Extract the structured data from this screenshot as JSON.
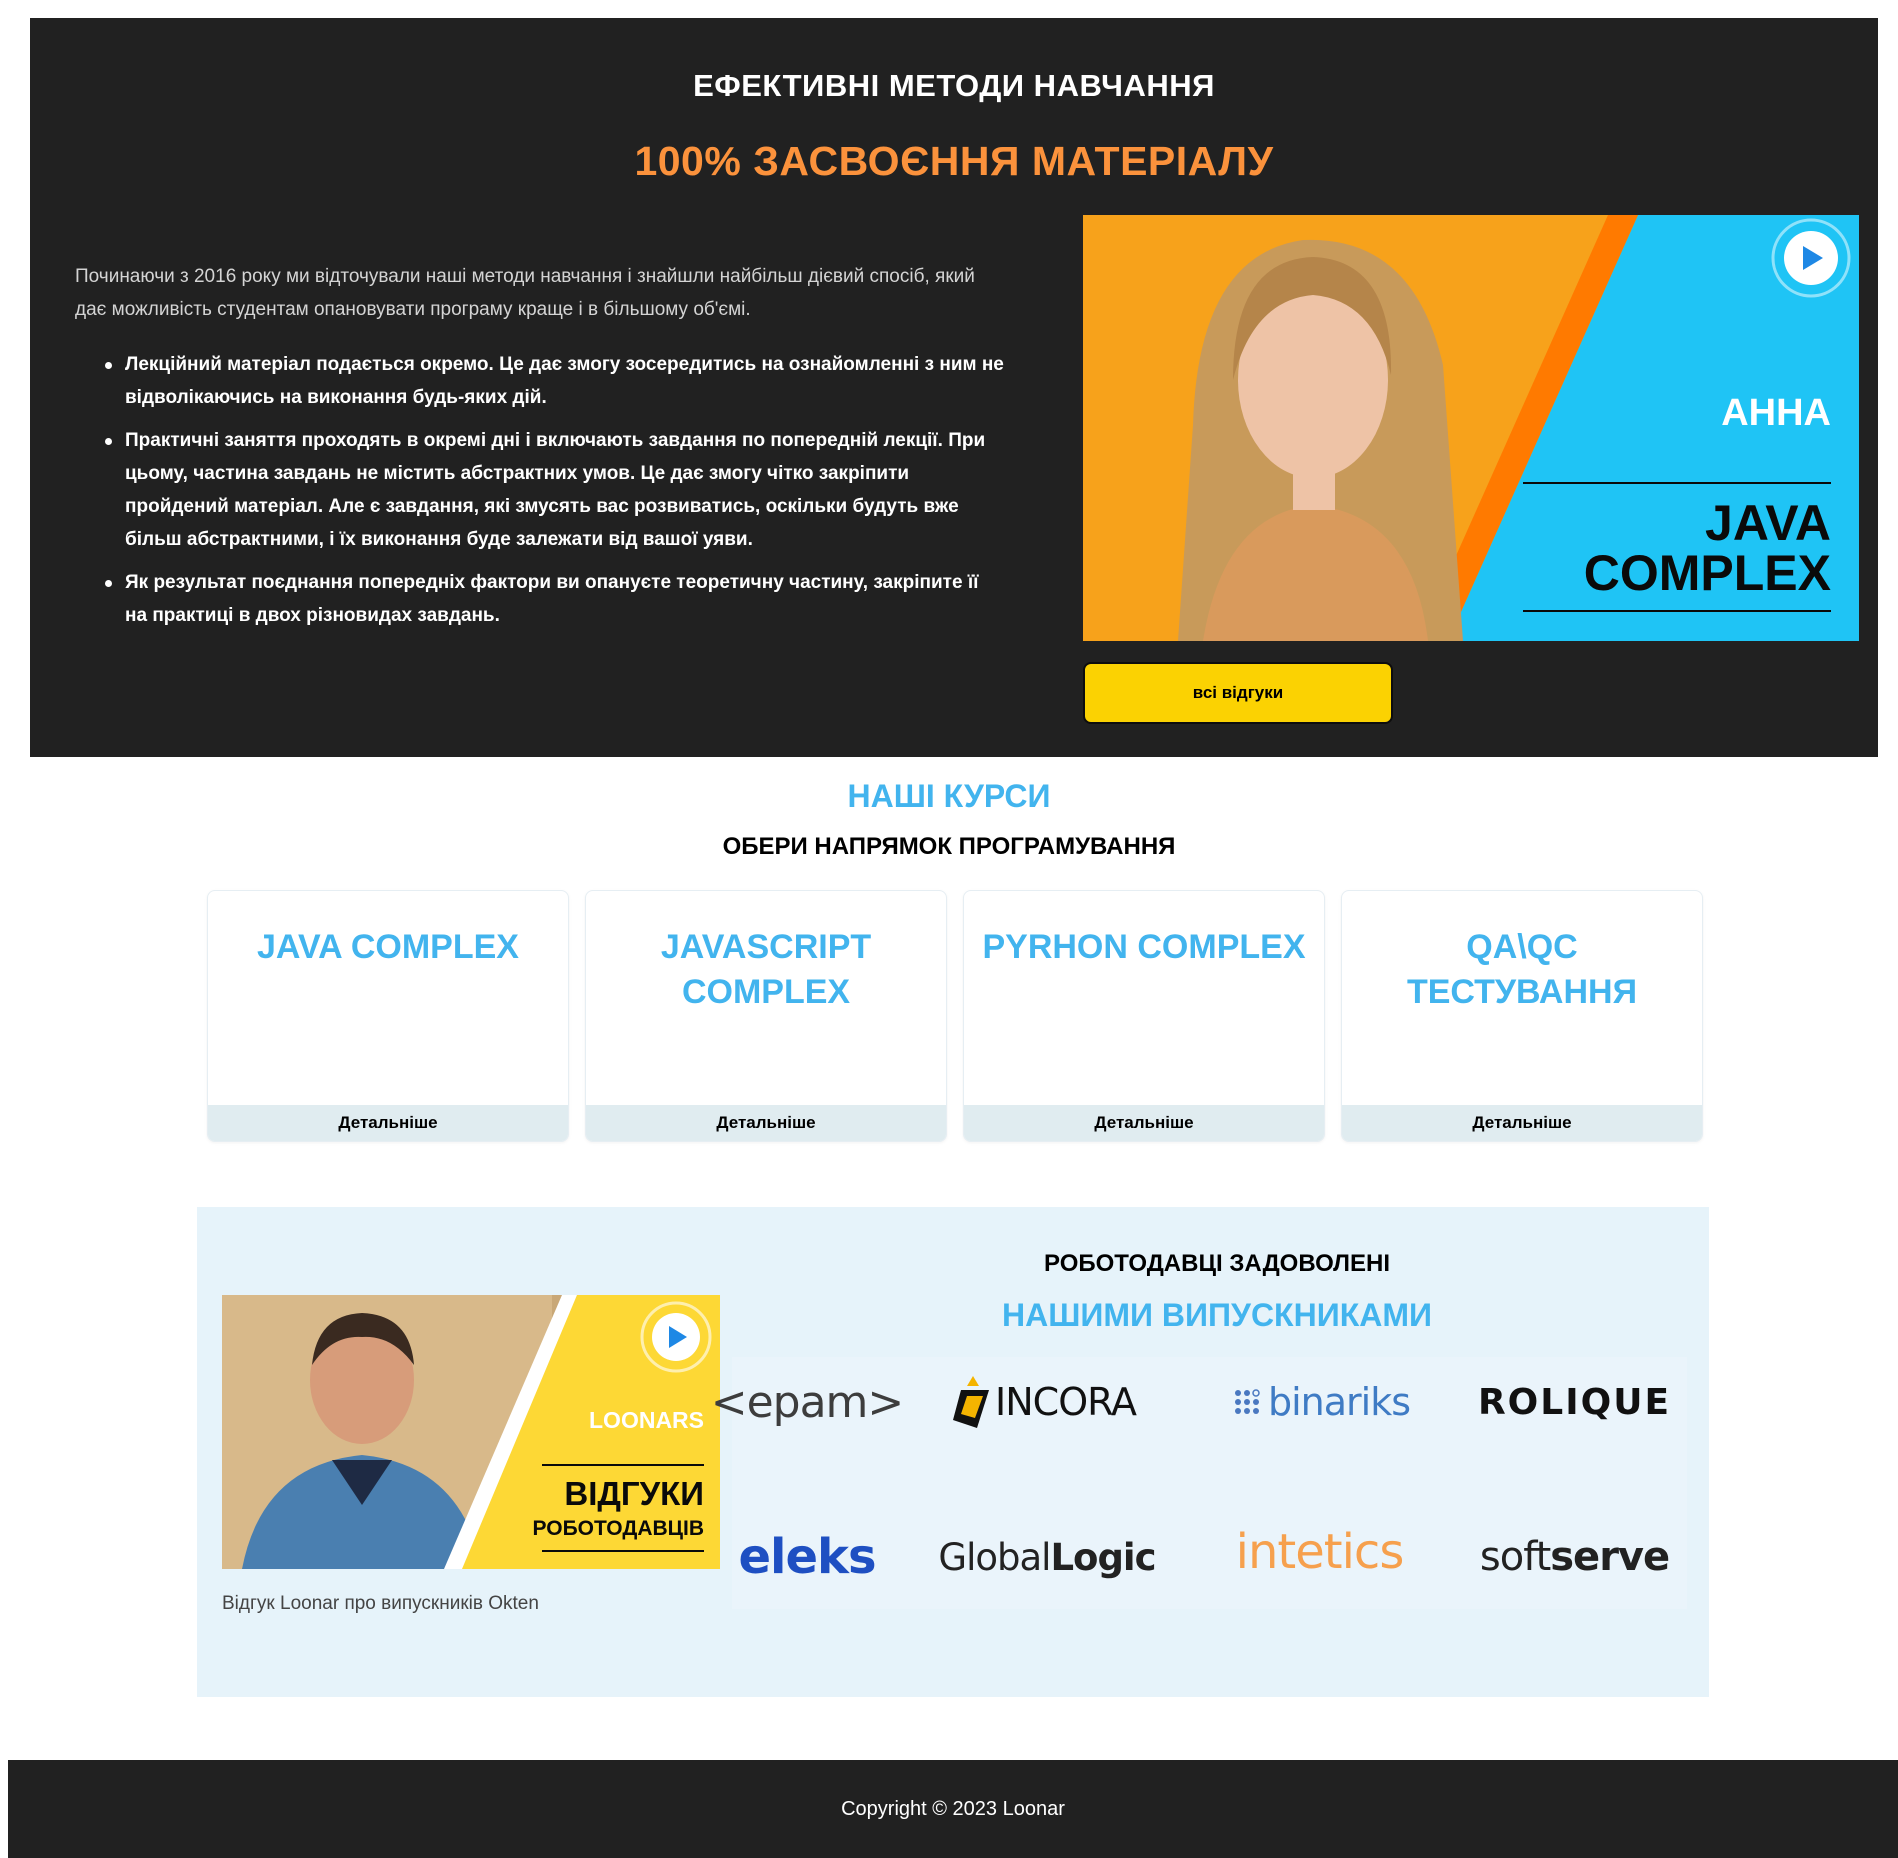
{
  "hero": {
    "title": "ЕФЕКТИВНІ МЕТОДИ НАВЧАННЯ",
    "subtitle": "100% ЗАСВОЄННЯ МАТЕРІАЛУ",
    "intro": "Починаючи з 2016 року ми відточували наші методи навчання і знайшли найбільш дієвий спосіб, який дає можливість студентам опановувати програму краще і в більшому об'ємі.",
    "bullets": [
      "Лекційний матеріал подається окремо. Це дає змогу зосередитись на ознайомленні з ним не відволікаючись на виконання будь-яких дій.",
      "Практичні заняття проходять в окремі дні і включають завдання по попередній лекції. При цьому, частина завдань не містить абстрактних умов. Це дає змогу чітко закріпити пройдений матеріал. Але є завдання, які змусять вас розвиватись, оскільки будуть вже більш абстрактними, і їх виконання буде залежати від вашої уяви.",
      "Як результат поєднання попередніх фактори ви опануєте теоретичну частину, закріпите її на практиці в двох різновидах завдань."
    ],
    "video": {
      "name": "АННА",
      "course_line1": "JAVA",
      "course_line2": "COMPLEX",
      "icon": "play-icon",
      "colors": {
        "orange": "#f7a21b",
        "blue": "#1fc4f5",
        "stripe": "#ff7a00"
      }
    },
    "reviews_button": "всі відгуки"
  },
  "courses": {
    "title": "НАШІ КУРСИ",
    "subtitle": "ОБЕРИ НАПРЯМОК ПРОГРАМУВАННЯ",
    "items": [
      {
        "line1": "JAVA COMPLEX",
        "line2": "",
        "more": "Детальніше"
      },
      {
        "line1": "JAVASCRIPT",
        "line2": "COMPLEX",
        "more": "Детальніше"
      },
      {
        "line1": "PYRHON COMPLEX",
        "line2": "",
        "more": "Детальніше"
      },
      {
        "line1": "QA\\QC",
        "line2": "ТЕСТУВАННЯ",
        "more": "Детальніше"
      }
    ]
  },
  "employers": {
    "title": "РОБОТОДАВЦІ ЗАДОВОЛЕНІ",
    "subtitle": "НАШИМИ ВИПУСКНИКАМИ",
    "video": {
      "brand": "LOONARS",
      "line1": "ВІДГУКИ",
      "line2": "РОБОТОДАВЦІВ",
      "icon": "play-icon",
      "colors": {
        "yellow": "#fdd835"
      }
    },
    "caption": "Відгук Loonar про випускників Okten",
    "logos": {
      "epam": "<epam>",
      "incora": "INCORA",
      "binariks": "binariks",
      "rolique": "ROLIQUE",
      "eleks": "eleks",
      "globallogic_a": "Global",
      "globallogic_b": "Logic",
      "intetics": "intetics",
      "softserve_a": "soft",
      "softserve_b": "serve"
    }
  },
  "footer": {
    "copyright": "Copyright © 2023 Loonar"
  },
  "colors": {
    "dark": "#212121",
    "accent_orange": "#fb923c",
    "accent_blue": "#42b4ee",
    "button_yellow": "#fbd202",
    "employers_bg": "#e6f3fa"
  }
}
